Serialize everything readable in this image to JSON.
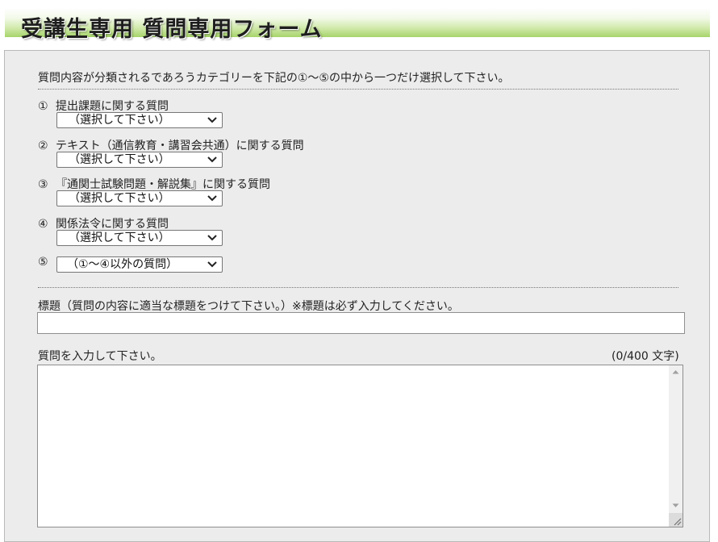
{
  "header": {
    "title": "受講生専用 質問専用フォーム"
  },
  "intro": "質問内容が分類されるであろうカテゴリーを下記の①～⑤の中から一つだけ選択して下さい。",
  "categories": [
    {
      "number": "①",
      "label": "提出課題に関する質問",
      "selected": "（選択して下さい）"
    },
    {
      "number": "②",
      "label": "テキスト（通信教育・講習会共通）に関する質問",
      "selected": "（選択して下さい）"
    },
    {
      "number": "③",
      "label": "『通関士試験問題・解説集』に関する質問",
      "selected": "（選択して下さい）"
    },
    {
      "number": "④",
      "label": "関係法令に関する質問",
      "selected": "（選択して下さい）"
    },
    {
      "number": "⑤",
      "label": "",
      "selected": "（①～④以外の質問）"
    }
  ],
  "subject": {
    "label": "標題（質問の内容に適当な標題をつけて下さい。）※標題は必ず入力してください。",
    "value": ""
  },
  "question": {
    "label": "質問を入力して下さい。",
    "counter": "(0/400 文字)",
    "value": ""
  },
  "icons": {
    "select_arrow": "chevron-down-icon",
    "scroll_up": "scroll-up-arrow-icon",
    "scroll_down": "scroll-down-arrow-icon",
    "resize": "resize-grip-icon"
  },
  "colors": {
    "header_gradient_end": "#a6d46a",
    "panel_background": "#ececec"
  }
}
